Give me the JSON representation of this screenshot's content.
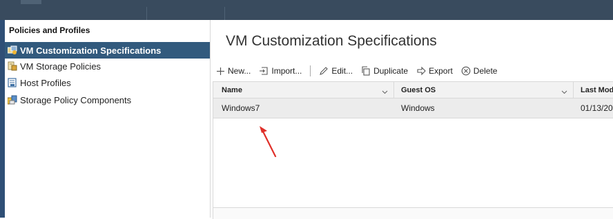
{
  "sidebar": {
    "title": "Policies and Profiles",
    "items": [
      {
        "label": "VM Customization Specifications",
        "icon": "vm-customization-icon",
        "selected": true
      },
      {
        "label": "VM Storage Policies",
        "icon": "storage-policy-icon",
        "selected": false
      },
      {
        "label": "Host Profiles",
        "icon": "host-profile-icon",
        "selected": false
      },
      {
        "label": "Storage Policy Components",
        "icon": "storage-component-icon",
        "selected": false
      }
    ]
  },
  "main": {
    "title": "VM Customization Specifications",
    "toolbar": {
      "new_label": "New...",
      "import_label": "Import...",
      "edit_label": "Edit...",
      "duplicate_label": "Duplicate",
      "export_label": "Export",
      "delete_label": "Delete"
    },
    "table": {
      "columns": [
        "Name",
        "Guest OS",
        "Last Mod"
      ],
      "rows": [
        {
          "name": "Windows7",
          "guest_os": "Windows",
          "last_modified": "01/13/202"
        }
      ]
    }
  },
  "colors": {
    "topbar": "#394b5e",
    "selected": "#325a7d",
    "annotation_arrow": "#e0302a"
  }
}
